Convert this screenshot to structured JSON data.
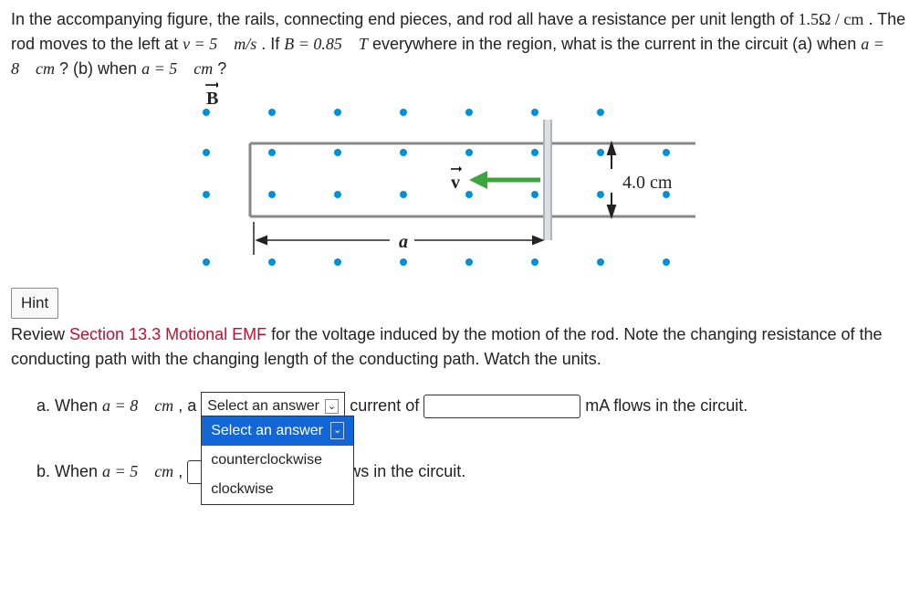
{
  "problem": {
    "intro1": "In the accompanying figure, the rails, connecting end pieces, and rod all have a resistance per unit length of ",
    "res": "1.5Ω / cm",
    "intro2": ". The rod moves to the left at ",
    "v_eq": "v = 5 m/s",
    "intro3": ". If ",
    "b_eq": "B = 0.85 T",
    "intro4": " everywhere in the region, what is the current in the circuit (a) when ",
    "a1_eq": "a = 8 cm",
    "intro5": "? (b) when ",
    "a2_eq": "a = 5 cm",
    "intro6": "?"
  },
  "figure": {
    "B": "B",
    "v": "v",
    "a": "a",
    "height": "4.0 cm"
  },
  "hint": {
    "label": "Hint",
    "text1": "Review ",
    "link": "Section 13.3 Motional EMF",
    "text2": " for the voltage induced by the motion of the rod. Note the changing resistance of the conducting path with the changing length of the conducting path. Watch the units."
  },
  "qa": {
    "a_prefix": "a. When ",
    "a_eq": "a = 8 cm",
    "a_mid": ", a ",
    "a_after_select": " current of ",
    "a_tail": " mA flows in the circuit.",
    "b_prefix": "b. When ",
    "b_eq": "a = 5 cm",
    "b_mid": ", ",
    "b_tail": " mA flows in the circuit."
  },
  "dropdown": {
    "placeholder": "Select an answer",
    "opt1": "counterclockwise",
    "opt2": "clockwise"
  }
}
